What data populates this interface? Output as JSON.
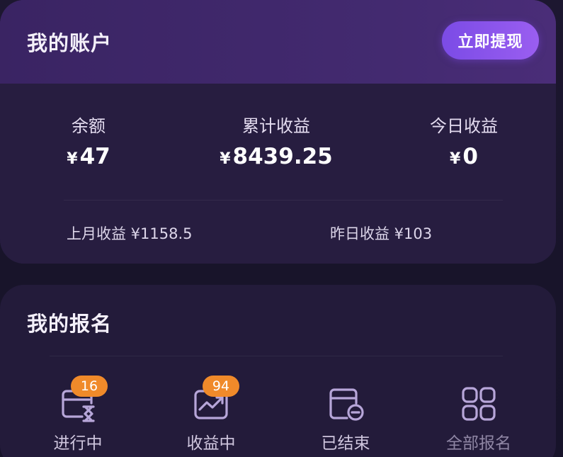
{
  "account": {
    "title": "我的账户",
    "withdraw_label": "立即提现",
    "stats": [
      {
        "label": "余额",
        "currency": "¥",
        "value": "47"
      },
      {
        "label": "累计收益",
        "currency": "¥",
        "value": "8439.25"
      },
      {
        "label": "今日收益",
        "currency": "¥",
        "value": "0"
      }
    ],
    "last_month": "上月收益 ¥1158.5",
    "yesterday": "昨日收益 ¥103"
  },
  "signup": {
    "title": "我的报名",
    "tiles": [
      {
        "label": "进行中",
        "badge": "16",
        "icon": "hourglass-card-icon"
      },
      {
        "label": "收益中",
        "badge": "94",
        "icon": "trend-chart-icon"
      },
      {
        "label": "已结束",
        "badge": "",
        "icon": "card-minus-icon"
      },
      {
        "label": "全部报名",
        "badge": "",
        "icon": "grid-apps-icon"
      }
    ]
  },
  "colors": {
    "accent": "#8b55ec",
    "badge": "#f08a2a",
    "card_bg": "#271d40",
    "icon_stroke": "#b7a6d9"
  }
}
